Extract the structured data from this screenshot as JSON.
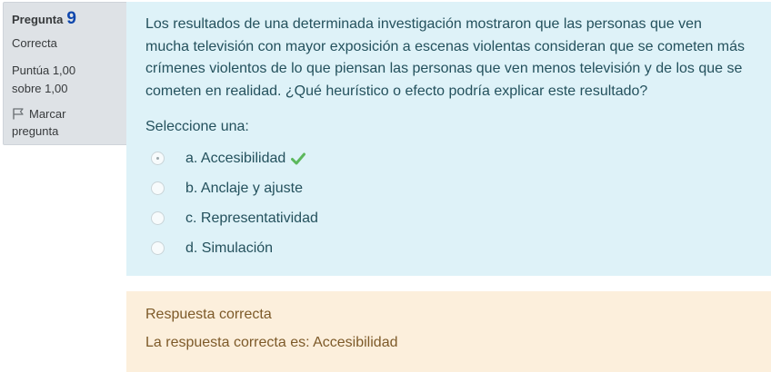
{
  "info": {
    "question_label": "Pregunta",
    "question_number": "9",
    "state": "Correcta",
    "grade_line1": "Puntúa 1,00",
    "grade_line2": "sobre 1,00",
    "flag_line1": "Marcar",
    "flag_line2": "pregunta"
  },
  "question": {
    "text": "Los resultados de una determinada investigación mostraron que las personas que ven mucha televisión con mayor exposición a escenas violentas consideran que se cometen más crímenes violentos de lo que piensan las personas que ven menos televisión y de los que se cometen en realidad. ¿Qué heurístico o efecto podría explicar este resultado?",
    "prompt": "Seleccione una:",
    "answers": [
      {
        "label": "a. Accesibilidad",
        "selected": true,
        "correct": true
      },
      {
        "label": "b. Anclaje y ajuste",
        "selected": false
      },
      {
        "label": "c. Representatividad",
        "selected": false
      },
      {
        "label": "d. Simulación",
        "selected": false
      }
    ]
  },
  "feedback": {
    "result": "Respuesta correcta",
    "right_answer": "La respuesta correcta es: Accesibilidad"
  },
  "colors": {
    "info_bg": "#dee2e6",
    "question_number": "#0f47ad",
    "content_bg": "#def2f8",
    "feedback_bg": "#fcefdc",
    "correct_check": "#5cb85c"
  },
  "icons": {
    "flag": "flag-icon",
    "correct": "check-icon"
  }
}
